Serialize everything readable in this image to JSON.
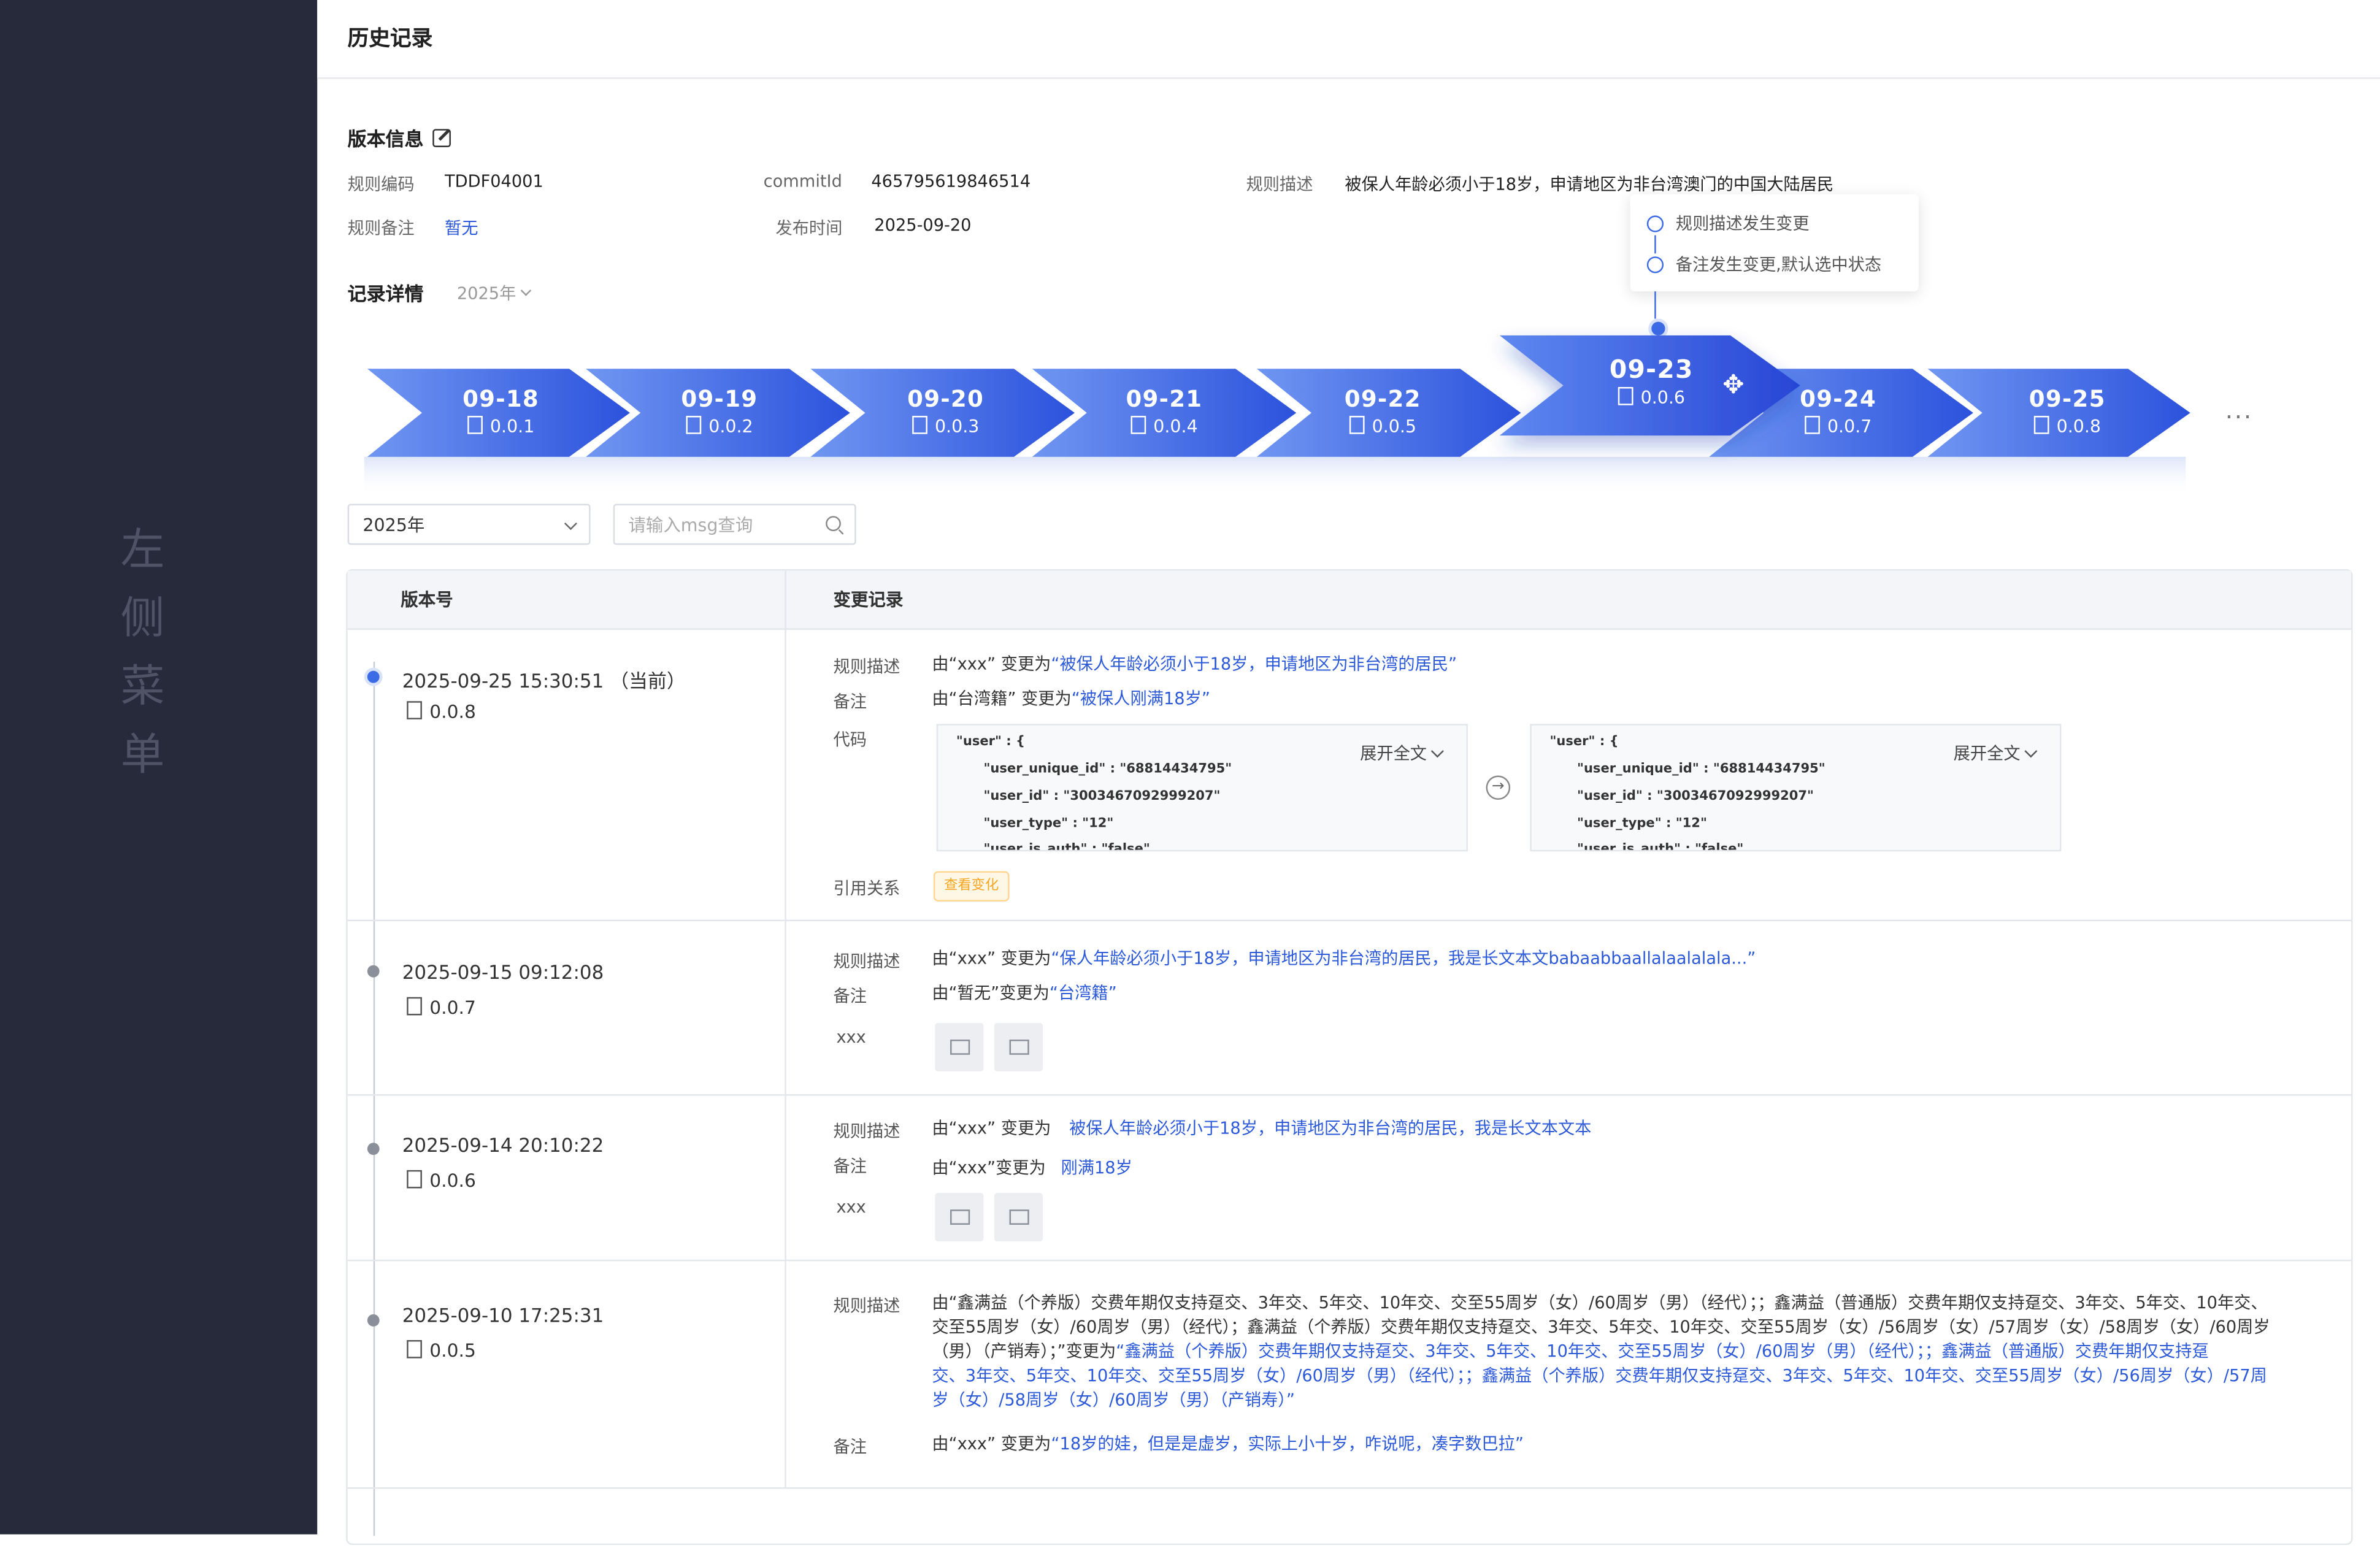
{
  "sidebar": {
    "title_chars": [
      "左",
      "侧",
      "菜",
      "单"
    ]
  },
  "header": {
    "title": "历史记录"
  },
  "version_info": {
    "title": "版本信息",
    "rule_code_label": "规则编码",
    "rule_code": "TDDF04001",
    "commit_label": "commitId",
    "commit": "465795619846514",
    "rule_desc_label": "规则描述",
    "rule_desc": "被保人年龄必须小于18岁，申请地区为非台湾澳门的中国大陆居民",
    "remark_label": "规则备注",
    "remark": "暂无",
    "publish_label": "发布时间",
    "publish": "2025-09-20"
  },
  "record": {
    "title": "记录详情",
    "year": "2025年"
  },
  "popup": {
    "items": [
      "规则描述发生变更",
      "备注发生变更,默认选中状态"
    ]
  },
  "timeline": [
    {
      "date": "09-18",
      "ver": "0.0.1"
    },
    {
      "date": "09-19",
      "ver": "0.0.2"
    },
    {
      "date": "09-20",
      "ver": "0.0.3"
    },
    {
      "date": "09-21",
      "ver": "0.0.4"
    },
    {
      "date": "09-22",
      "ver": "0.0.5"
    },
    {
      "date": "09-23",
      "ver": "0.0.6"
    },
    {
      "date": "09-24",
      "ver": "0.0.7"
    },
    {
      "date": "09-25",
      "ver": "0.0.8"
    }
  ],
  "more": "···",
  "filters": {
    "year": "2025年",
    "search_placeholder": "请输入msg查询"
  },
  "table": {
    "col_version": "版本号",
    "col_changes": "变更记录",
    "rows": [
      {
        "time": "2025-09-25 15:30:51 （当前）",
        "ver": "0.0.8",
        "desc_label": "规则描述",
        "desc_prefix": "由“xxx” 变更为",
        "desc_new": "“被保人年龄必须小于18岁，申请地区为非台湾的居民”",
        "remark_label": "备注",
        "remark_prefix": "由“台湾籍” 变更为",
        "remark_new": "“被保人刚满18岁”",
        "code_label": "代码",
        "expand": "展开全文",
        "code_lines": [
          "\"user\" : {",
          "\"user_unique_id\" : \"68814434795\"",
          "\"user_id\" : \"3003467092999207\"",
          "\"user_type\" : \"12\"",
          "\"user_is_auth\" : \"false\""
        ],
        "ref_label": "引用关系",
        "ref_tag": "查看变化"
      },
      {
        "time": "2025-09-15  09:12:08",
        "ver": "0.0.7",
        "desc_label": "规则描述",
        "desc_prefix": "由“xxx” 变更为",
        "desc_new": "“保人年龄必须小于18岁，申请地区为非台湾的居民，我是长文本文babaabbaallalaalalala...”",
        "remark_label": "备注",
        "remark_prefix": "由“暂无”变更为",
        "remark_new": "“台湾籍”",
        "x_label": "xxx"
      },
      {
        "time": "2025-09-14  20:10:22",
        "ver": "0.0.6",
        "desc_label": "规则描述",
        "desc_prefix": "由“xxx” 变更为",
        "desc_new": "被保人年龄必须小于18岁，申请地区为非台湾的居民，我是长文本文本",
        "remark_label": "备注",
        "remark_prefix": "由“xxx”变更为",
        "remark_new": "刚满18岁",
        "x_label": "xxx"
      },
      {
        "time": "2025-09-10  17:25:31",
        "ver": "0.0.5",
        "desc_label": "规则描述",
        "desc_line1": "由“鑫满益（个养版）交费年期仅支持趸交、3年交、5年交、10年交、交至55周岁（女）/60周岁（男）（经代）；；鑫满益（普通版）交费年期仅支持趸交、3年交、5年交、10年交、",
        "desc_line2": "交至55周岁（女）/60周岁（男）（经代）；鑫满益（个养版）交费年期仅支持趸交、3年交、5年交、10年交、交至55周岁（女）/56周岁（女）/57周岁（女）/58周岁（女）/60周岁",
        "desc_line3_a": "（男）（产销寿）；”变更为",
        "desc_line3_b": "“鑫满益（个养版）交费年期仅支持趸交、3年交、5年交、10年交、交至55周岁（女）/60周岁（男）（经代）；；鑫满益（普通版）交费年期仅支持趸",
        "desc_line4": "交、3年交、5年交、10年交、交至55周岁（女）/60周岁（男）（经代）；；鑫满益（个养版）交费年期仅支持趸交、3年交、5年交、10年交、交至55周岁（女）/56周岁（女）/57周",
        "desc_line5": "岁（女）/58周岁（女）/60周岁（男）（产销寿）”",
        "remark_label": "备注",
        "remark_prefix": "由“xxx” 变更为",
        "remark_new": "“18岁的娃，但是是虚岁，实际上小十岁，咋说呢，凑字数巴拉”"
      }
    ]
  },
  "colors": {
    "sidebar": "#262a3b",
    "accent": "#3c6be6",
    "chevron_start": "#6b8ff0",
    "chevron_end": "#2c52dd"
  }
}
